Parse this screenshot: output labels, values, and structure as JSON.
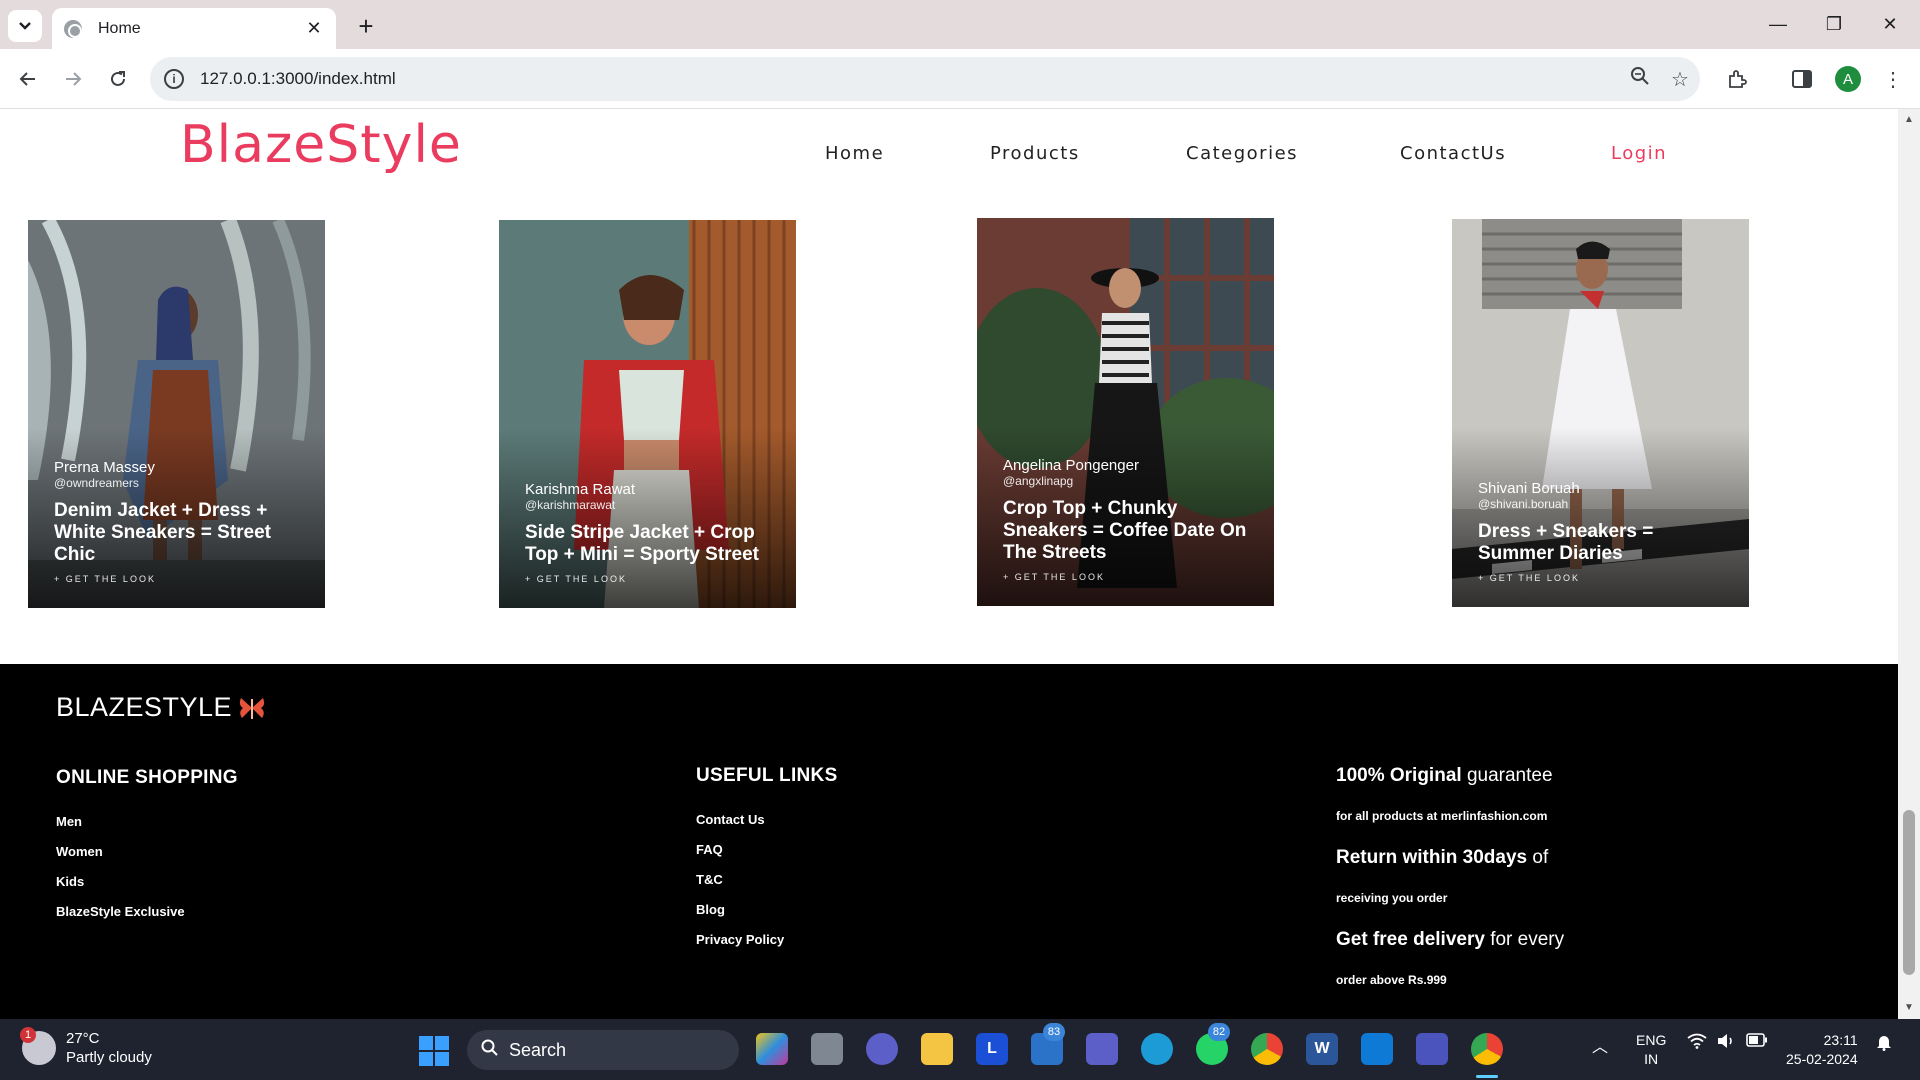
{
  "browser": {
    "tab_title": "Home",
    "url": "127.0.0.1:3000/index.html",
    "profile_initial": "A"
  },
  "site": {
    "logo": "BlazeStyle",
    "nav": [
      "Home",
      "Products",
      "Categories",
      "ContactUs"
    ],
    "login": "Login",
    "accent_color": "#ea3c5e"
  },
  "looks": [
    {
      "name": "Prerna Massey",
      "handle": "@owndreamers",
      "title": "Denim Jacket + Dress + White Sneakers = Street Chic",
      "cta": "+ GET THE LOOK"
    },
    {
      "name": "Karishma Rawat",
      "handle": "@karishmarawat",
      "title": "Side Stripe Jacket + Crop Top + Mini = Sporty Street",
      "cta": "+ GET THE LOOK"
    },
    {
      "name": "Angelina Pongenger",
      "handle": "@angxlinapg",
      "title": "Crop Top + Chunky Sneakers = Coffee Date On The Streets",
      "cta": "+ GET THE LOOK"
    },
    {
      "name": "Shivani Boruah",
      "handle": "@shivani.boruah",
      "title": "Dress + Sneakers = Summer Diaries",
      "cta": "+ GET THE LOOK"
    }
  ],
  "footer": {
    "logo": "BLAZESTYLE",
    "online_shopping": {
      "heading": "ONLINE SHOPPING",
      "links": [
        "Men",
        "Women",
        "Kids",
        "BlazeStyle Exclusive"
      ]
    },
    "useful_links": {
      "heading": "USEFUL LINKS",
      "links": [
        "Contact Us",
        "FAQ",
        "T&C",
        "Blog",
        "Privacy Policy"
      ]
    },
    "promises": [
      {
        "bold": "100% Original",
        "rest": " guarantee",
        "sub": "for all products at merlinfashion.com"
      },
      {
        "bold": "Return within 30days",
        "rest": " of",
        "sub": "receiving you order"
      },
      {
        "bold": "Get free delivery",
        "rest": " for every",
        "sub": "order above Rs.999"
      }
    ]
  },
  "taskbar": {
    "weather_temp": "27°C",
    "weather_desc": "Partly cloudy",
    "weather_badge": "1",
    "search_label": "Search",
    "mail_badge": "83",
    "whatsapp_badge": "82",
    "lang_top": "ENG",
    "lang_bottom": "IN",
    "time": "23:11",
    "date": "25-02-2024"
  }
}
